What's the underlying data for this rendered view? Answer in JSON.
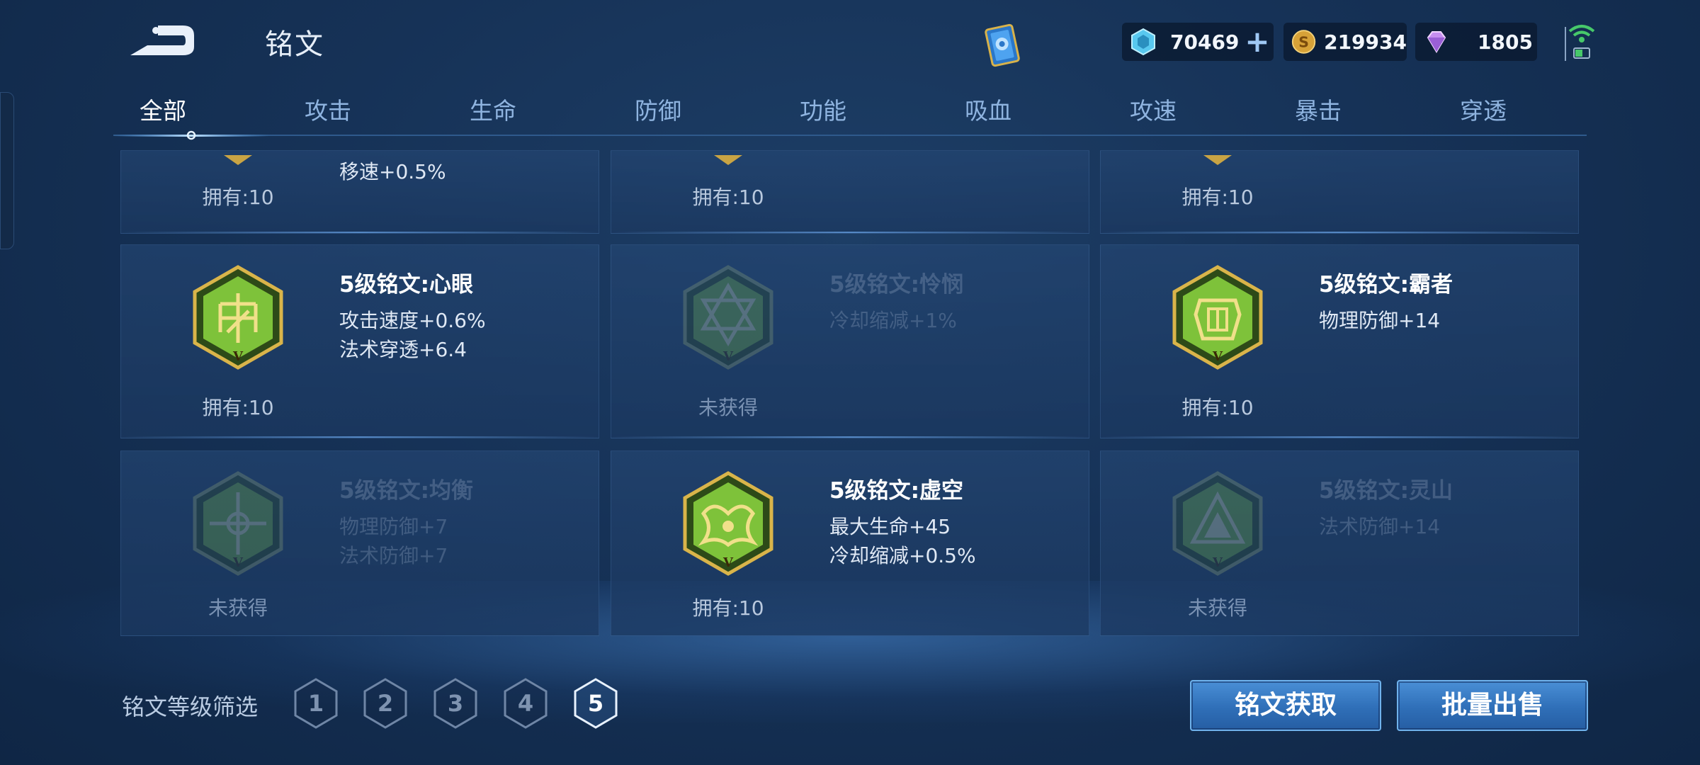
{
  "header": {
    "title": "铭文",
    "currencies": [
      {
        "icon": "crystal-icon",
        "value": "70469"
      },
      {
        "icon": "gold-coin-icon",
        "value": "219934"
      },
      {
        "icon": "diamond-icon",
        "value": "1805"
      }
    ]
  },
  "tabs": [
    {
      "label": "全部",
      "active": true
    },
    {
      "label": "攻击"
    },
    {
      "label": "生命"
    },
    {
      "label": "防御"
    },
    {
      "label": "功能"
    },
    {
      "label": "吸血"
    },
    {
      "label": "攻速"
    },
    {
      "label": "暴击"
    },
    {
      "label": "穿透"
    }
  ],
  "cards_partial": [
    {
      "stat": "移速+0.5%",
      "owned": "拥有:10"
    },
    {
      "owned": "拥有:10"
    },
    {
      "owned": "拥有:10"
    }
  ],
  "cards": [
    {
      "name": "5级铭文:心眼",
      "stats": [
        "攻击速度+0.6%",
        "法术穿透+6.4"
      ],
      "owned": "拥有:10",
      "obtained": true
    },
    {
      "name": "5级铭文:怜悯",
      "stats": [
        "冷却缩减+1%"
      ],
      "owned": "未获得",
      "obtained": false
    },
    {
      "name": "5级铭文:霸者",
      "stats": [
        "物理防御+14"
      ],
      "owned": "拥有:10",
      "obtained": true
    },
    {
      "name": "5级铭文:均衡",
      "stats": [
        "物理防御+7",
        "法术防御+7"
      ],
      "owned": "未获得",
      "obtained": false
    },
    {
      "name": "5级铭文:虚空",
      "stats": [
        "最大生命+45",
        "冷却缩减+0.5%"
      ],
      "owned": "拥有:10",
      "obtained": true
    },
    {
      "name": "5级铭文:灵山",
      "stats": [
        "法术防御+14"
      ],
      "owned": "未获得",
      "obtained": false
    }
  ],
  "filter": {
    "label": "铭文等级筛选",
    "levels": [
      "1",
      "2",
      "3",
      "4",
      "5"
    ],
    "selected": "5"
  },
  "buttons": {
    "acquire": "铭文获取",
    "bulk_sell": "批量出售"
  },
  "colors": {
    "rune_green": "#7ec23a",
    "rune_gold": "#d9b44a",
    "button_blue": "#3a7fc8"
  }
}
